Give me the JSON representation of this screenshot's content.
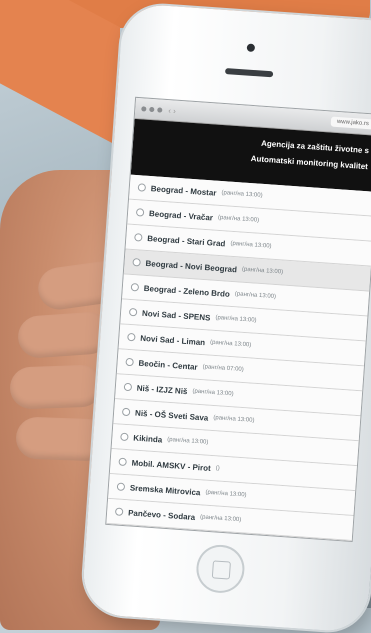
{
  "browser": {
    "url": "www.jako.rs",
    "nav_arrows": "‹  ›"
  },
  "header": {
    "line1": "Agencija za zaštitu životne s",
    "line2": "Automatski monitoring kvalitet"
  },
  "stations": [
    {
      "name": "Beograd - Mostar",
      "meta": "(ранг/на 13:00)"
    },
    {
      "name": "Beograd - Vračar",
      "meta": "(ранг/на 13:00)"
    },
    {
      "name": "Beograd - Stari Grad",
      "meta": "(ранг/на 13:00)"
    },
    {
      "name": "Beograd - Novi Beograd",
      "meta": "(ранг/на 13:00)"
    },
    {
      "name": "Beograd - Zeleno Brdo",
      "meta": "(ранг/на 13:00)"
    },
    {
      "name": "Novi Sad - SPENS",
      "meta": "(ранг/на 13:00)"
    },
    {
      "name": "Novi Sad - Liman",
      "meta": "(ранг/на 13:00)"
    },
    {
      "name": "Beočin - Centar",
      "meta": "(ранг/на 07:00)"
    },
    {
      "name": "Niš - IZJZ Niš",
      "meta": "(ранг/на 13:00)"
    },
    {
      "name": "Niš - OŠ Sveti Sava",
      "meta": "(ранг/на 13:00)"
    },
    {
      "name": "Kikinda",
      "meta": "(ранг/на 13:00)"
    },
    {
      "name": "Mobil. AMSKV - Pirot",
      "meta": "()"
    },
    {
      "name": "Sremska Mitrovica",
      "meta": "(ранг/на 13:00)"
    },
    {
      "name": "Pančevo - Sodara",
      "meta": "(ранг/на 13:00)"
    }
  ]
}
